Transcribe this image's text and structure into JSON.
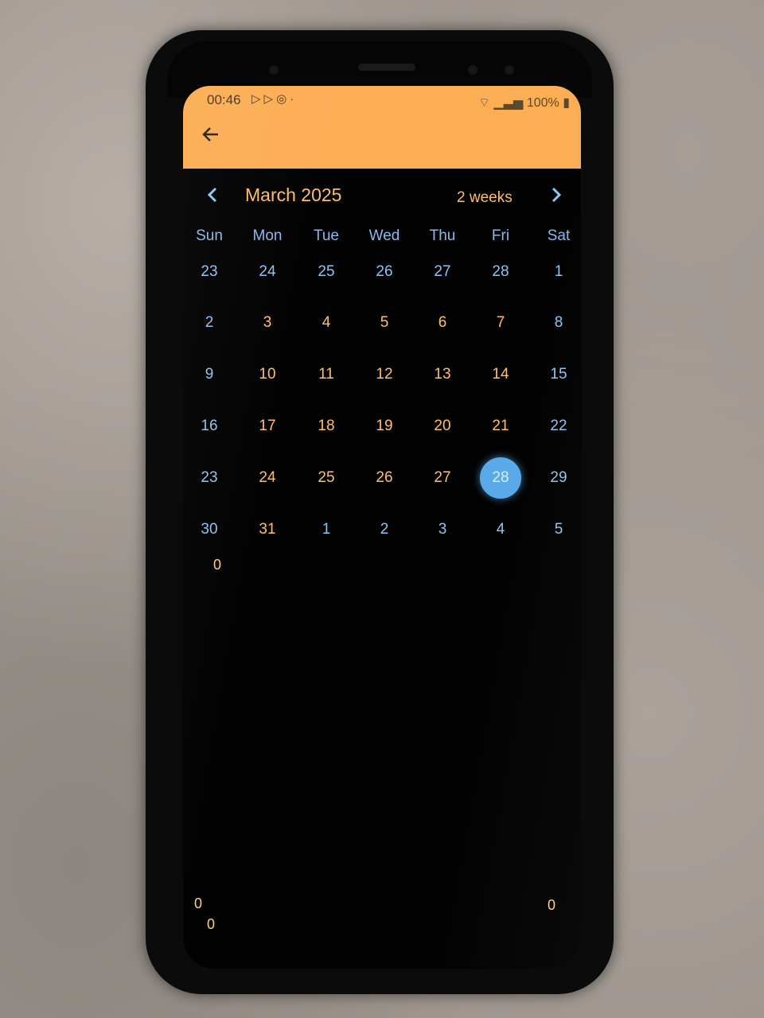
{
  "status_bar": {
    "time": "00:46",
    "notification_icons": [
      "play-store-icon",
      "play-store-icon",
      "target-icon"
    ],
    "battery": "100%"
  },
  "toolbar": {
    "back_icon": "arrow-left-icon"
  },
  "calendar": {
    "title": "March 2025",
    "view_mode": "2 weeks",
    "prev_icon": "chevron-left-icon",
    "next_icon": "chevron-right-icon",
    "weekdays": [
      "Sun",
      "Mon",
      "Tue",
      "Wed",
      "Thu",
      "Fri",
      "Sat"
    ],
    "weeks": [
      [
        "23",
        "24",
        "25",
        "26",
        "27",
        "28",
        "1"
      ],
      [
        "2",
        "3",
        "4",
        "5",
        "6",
        "7",
        "8"
      ],
      [
        "9",
        "10",
        "11",
        "12",
        "13",
        "14",
        "15"
      ],
      [
        "16",
        "17",
        "18",
        "19",
        "20",
        "21",
        "22"
      ],
      [
        "23",
        "24",
        "25",
        "26",
        "27",
        "28",
        "29"
      ],
      [
        "30",
        "31",
        "1",
        "2",
        "3",
        "4",
        "5"
      ]
    ],
    "selected_day": "28"
  },
  "counters": {
    "top_left": "0",
    "bottom_left_a": "0",
    "bottom_left_b": "0",
    "bottom_right": "0"
  },
  "colors": {
    "app_bar": "#fcae55",
    "accent_orange": "#ffc06b",
    "accent_blue": "#8fc4ef",
    "selected_circle": "#5aaae9",
    "background": "#020202"
  }
}
